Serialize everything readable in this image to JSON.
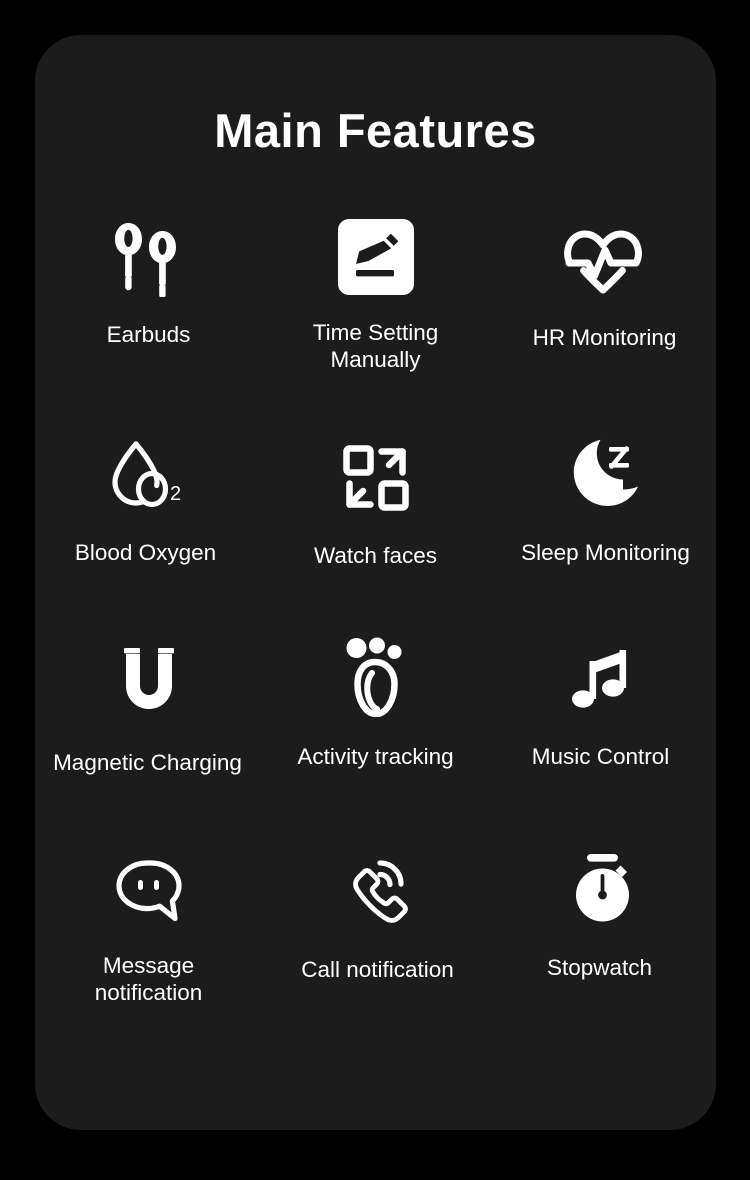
{
  "page": {
    "title": "Main Features",
    "background_color": "#000000",
    "card_color": "#1c1c1c",
    "text_color": "#ffffff"
  },
  "features": [
    {
      "label": "Earbuds",
      "icon": "earbuds-icon"
    },
    {
      "label": "Time Setting\nManually",
      "icon": "edit-pencil-icon"
    },
    {
      "label": "HR Monitoring",
      "icon": "heart-pulse-icon"
    },
    {
      "label": "Blood Oxygen",
      "icon": "blood-oxygen-droplet-icon"
    },
    {
      "label": "Watch faces",
      "icon": "watch-faces-grid-icon"
    },
    {
      "label": "Sleep Monitoring",
      "icon": "moon-sleep-icon"
    },
    {
      "label": "Magnetic Charging",
      "icon": "magnet-icon"
    },
    {
      "label": "Activity tracking",
      "icon": "footprint-icon"
    },
    {
      "label": "Music Control",
      "icon": "music-note-icon"
    },
    {
      "label": "Message\nnotification",
      "icon": "speech-bubble-icon"
    },
    {
      "label": "Call notification",
      "icon": "phone-call-icon"
    },
    {
      "label": "Stopwatch",
      "icon": "stopwatch-icon"
    }
  ]
}
